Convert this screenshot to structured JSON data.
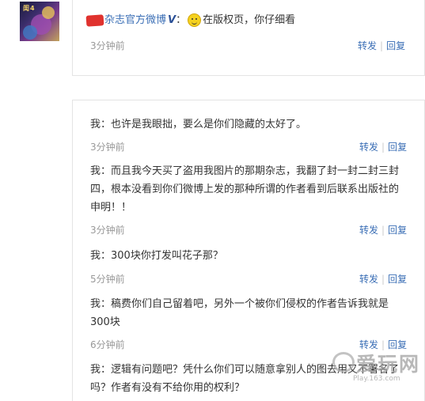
{
  "top_post": {
    "author": "杂志官方微博",
    "badge": "V",
    "separator": "：",
    "message": "在版权页，你仔细看",
    "time": "3分钟前",
    "forward": "转发",
    "reply": "回复",
    "sep": "|"
  },
  "comments": [
    {
      "text": "我：也许是我眼拙，要么是你们隐藏的太好了。",
      "time": "3分钟前",
      "forward": "转发",
      "reply": "回复"
    },
    {
      "text": "我：而且我今天买了盗用我图片的那期杂志，我翻了封一封二封三封四，根本没看到你们微博上发的那种所谓的作者看到后联系出版社的申明！！",
      "time": "3分钟前",
      "forward": "转发",
      "reply": "回复"
    },
    {
      "text": "我：300块你打发叫花子那？",
      "time": "5分钟前",
      "forward": "转发",
      "reply": "回复"
    },
    {
      "text": "我：稿费你们自己留着吧，另外一个被你们侵权的作者告诉我就是300块",
      "time": "6分钟前",
      "forward": "转发",
      "reply": "回复"
    },
    {
      "text": "我：逻辑有问题吧？凭什么你们可以随意拿别人的图去用又不署名了吗？作者有没有不给你用的权利？"
    }
  ],
  "avatar": {
    "text": "闺4"
  },
  "watermark": {
    "main": "爱玩网",
    "sub": "Play.163.com"
  },
  "colors": {
    "link": "#3a6eb5",
    "time": "#999999",
    "redaction": "#e0322e"
  }
}
